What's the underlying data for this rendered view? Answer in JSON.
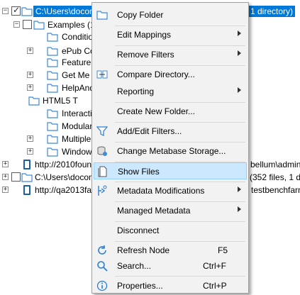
{
  "tree": {
    "root": {
      "label": "C:\\Users\\doconn",
      "suffix": "1 directory)",
      "expander": "−"
    },
    "examples": {
      "label": "Examples (10",
      "expander": "−"
    },
    "children": [
      {
        "label": "Condition",
        "expander": ""
      },
      {
        "label": "ePub Cov",
        "expander": "+"
      },
      {
        "label": "Feature",
        "expander": ""
      },
      {
        "label": "Get Me S",
        "expander": "+"
      },
      {
        "label": "HelpAndI",
        "expander": "+"
      },
      {
        "label": "HTML5 T",
        "expander": ""
      },
      {
        "label": "Interacti",
        "expander": ""
      },
      {
        "label": "Modular",
        "expander": ""
      },
      {
        "label": "Multiple",
        "expander": "+"
      },
      {
        "label": "Windows",
        "expander": "+"
      }
    ],
    "others": [
      {
        "left": "http://2010foun",
        "right": "bellum\\administ",
        "expander": "+"
      },
      {
        "left": "C:\\Users\\doconn",
        "right": "(352 files, 1 di",
        "expander": "+"
      },
      {
        "left": "http://qa2013far",
        "right": "testbenchfarm)",
        "expander": "+"
      }
    ]
  },
  "menu": {
    "items": [
      {
        "label": "Copy Folder",
        "shortcut": "",
        "submenu": false,
        "icon": "folder-icon"
      },
      {
        "label": "Edit Mappings",
        "shortcut": "",
        "submenu": true,
        "icon": ""
      },
      {
        "label": "Remove Filters",
        "shortcut": "",
        "submenu": true,
        "icon": ""
      },
      {
        "label": "Compare Directory...",
        "shortcut": "",
        "submenu": false,
        "icon": "compare-icon"
      },
      {
        "label": "Reporting",
        "shortcut": "",
        "submenu": true,
        "icon": ""
      },
      {
        "label": "Create New Folder...",
        "shortcut": "",
        "submenu": false,
        "icon": ""
      },
      {
        "label": "Add/Edit Filters...",
        "shortcut": "",
        "submenu": false,
        "icon": "filter-icon"
      },
      {
        "label": "Change Metabase Storage...",
        "shortcut": "",
        "submenu": false,
        "icon": "storage-icon"
      },
      {
        "label": "Show Files",
        "shortcut": "",
        "submenu": false,
        "icon": "files-icon"
      },
      {
        "label": "Metadata Modifications",
        "shortcut": "",
        "submenu": true,
        "icon": "metadata-icon"
      },
      {
        "label": "Managed Metadata",
        "shortcut": "",
        "submenu": true,
        "icon": ""
      },
      {
        "label": "Disconnect",
        "shortcut": "",
        "submenu": false,
        "icon": ""
      },
      {
        "label": "Refresh Node",
        "shortcut": "F5",
        "submenu": false,
        "icon": "refresh-icon"
      },
      {
        "label": "Search...",
        "shortcut": "Ctrl+F",
        "submenu": false,
        "icon": "search-icon"
      },
      {
        "label": "Properties...",
        "shortcut": "Ctrl+P",
        "submenu": false,
        "icon": "info-icon"
      }
    ],
    "highlighted": "Show Files"
  },
  "colors": {
    "selection": "#0078d7",
    "menu_highlight": "#cce8ff",
    "folder": "#4a9fe0"
  }
}
